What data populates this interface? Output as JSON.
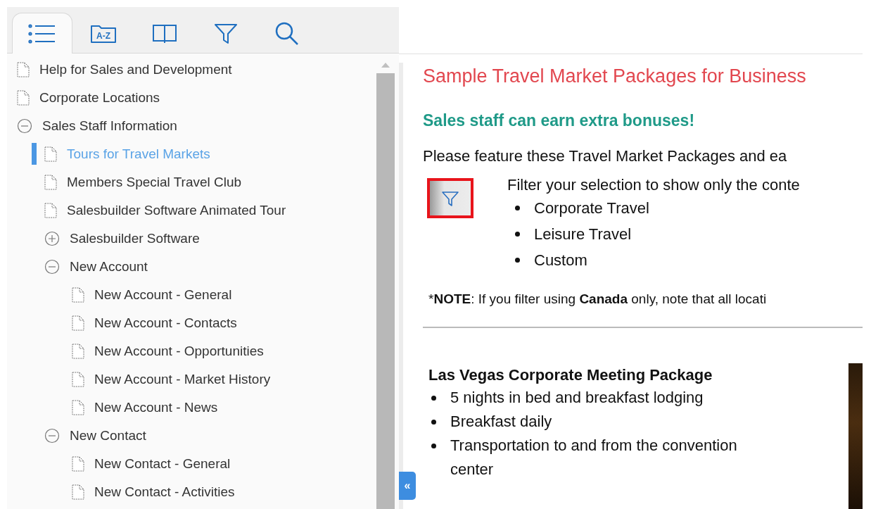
{
  "tabs": [
    {
      "kind": "contents",
      "selected": true
    },
    {
      "kind": "index",
      "label": "A-Z",
      "selected": false
    },
    {
      "kind": "glossary",
      "selected": false
    },
    {
      "kind": "filter",
      "selected": false
    },
    {
      "kind": "search",
      "selected": false
    }
  ],
  "tree": [
    {
      "kind": "page",
      "label": "Help for Sales and Development",
      "selected": false
    },
    {
      "kind": "page",
      "label": "Corporate Locations",
      "selected": false
    },
    {
      "kind": "book",
      "label": "Sales Staff Information",
      "selected": false,
      "expanded": true,
      "children": [
        {
          "kind": "page",
          "label": "Tours for Travel Markets",
          "selected": true
        },
        {
          "kind": "page",
          "label": "Members Special Travel Club",
          "selected": false
        },
        {
          "kind": "page",
          "label": "Salesbuilder Software Animated Tour",
          "selected": false
        },
        {
          "kind": "book",
          "label": "Salesbuilder Software",
          "selected": false,
          "expanded": false
        },
        {
          "kind": "book",
          "label": "New Account",
          "selected": false,
          "expanded": true,
          "children": [
            {
              "kind": "page",
              "label": "New Account - General",
              "selected": false
            },
            {
              "kind": "page",
              "label": "New Account - Contacts",
              "selected": false
            },
            {
              "kind": "page",
              "label": "New Account - Opportunities",
              "selected": false
            },
            {
              "kind": "page",
              "label": "New Account - Market History",
              "selected": false
            },
            {
              "kind": "page",
              "label": "New Account - News",
              "selected": false
            }
          ]
        },
        {
          "kind": "book",
          "label": "New Contact",
          "selected": false,
          "expanded": true,
          "children": [
            {
              "kind": "page",
              "label": "New Contact - General",
              "selected": false
            },
            {
              "kind": "page",
              "label": "New Contact - Activities",
              "selected": false
            }
          ]
        }
      ]
    }
  ],
  "collapse_button": "«",
  "content": {
    "heading": "Sample Travel Market Packages for Business",
    "subheading": "Sales staff can earn extra bonuses!",
    "intro": "Please feature these Travel Market Packages and ea",
    "filter_text": "Filter your selection to show only the conte",
    "filter_options": [
      "Corporate Travel",
      "Leisure Travel",
      "Custom"
    ],
    "note": [
      {
        "text": "*",
        "bold": false
      },
      {
        "text": "NOTE",
        "bold": true
      },
      {
        "text": ": If you filter using ",
        "bold": false
      },
      {
        "text": "Canada",
        "bold": true
      },
      {
        "text": " only, note that all locati",
        "bold": false
      }
    ],
    "package": {
      "title": "Las Vegas Corporate Meeting Package",
      "items": [
        "5 nights in bed and breakfast lodging",
        "Breakfast daily",
        "Transportation to and from the convention center"
      ]
    }
  }
}
